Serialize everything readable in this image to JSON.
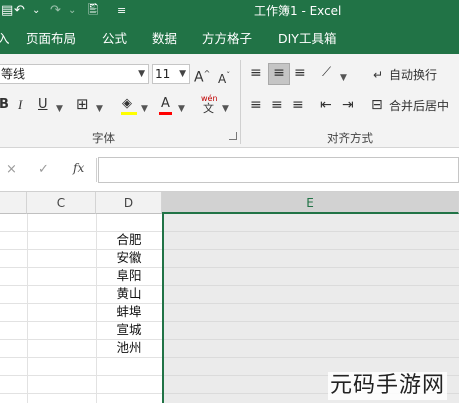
{
  "titlebar": {
    "title": "工作簿1  -  Excel",
    "undo_icon": "↶",
    "redo_icon": "↷",
    "dropdown_icon": "⌄",
    "print_preview_icon": "🖺",
    "customize_icon": "≡"
  },
  "menu": {
    "tabs": [
      "页面布局",
      "公式",
      "数据",
      "方方格子",
      "DIY工具箱"
    ]
  },
  "ribbon": {
    "font": {
      "name": "等线",
      "size": "11",
      "increase_label": "A",
      "decrease_label": "A",
      "bold": "B",
      "italic": "I",
      "underline": "U",
      "font_color": "A",
      "phonetic": "wén",
      "group_label": "字体"
    },
    "alignment": {
      "wrap_text": "自动换行",
      "merge_center": "合并后居中",
      "group_label": "对齐方式"
    }
  },
  "formula_bar": {
    "cancel": "×",
    "enter": "✓",
    "fx": "fx",
    "value": ""
  },
  "columns": [
    "C",
    "D",
    "E"
  ],
  "cells_d": [
    "合肥",
    "安徽",
    "阜阳",
    "黄山",
    "蚌埠",
    "宣城",
    "池州"
  ],
  "watermark": "元码手游网",
  "colors": {
    "accent": "#217346",
    "ribbon_bg": "#f3f3f3",
    "header_bg": "#f2f2f2"
  }
}
